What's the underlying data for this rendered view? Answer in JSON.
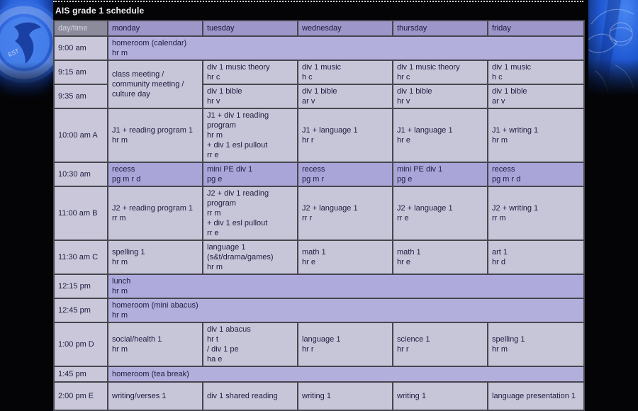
{
  "title": "AIS grade 1 schedule",
  "background": {
    "emblem_text": "EST",
    "emblem_blue": "#2a63dc"
  },
  "colors": {
    "header_purple": "#9c96c9",
    "header_gray": "#8c8b9b",
    "cell_light": "#c7c5d8",
    "homeroom_purple": "#b3afdd",
    "lunch_purple": "#aeaadc",
    "recess_purple": "#a9a5d8",
    "text_dark": "#1e1e40"
  },
  "columns": [
    "day/time",
    "monday",
    "tuesday",
    "wednesday",
    "thursday",
    "friday"
  ],
  "rows": [
    {
      "time": "9:00 am",
      "span": "homeroom (calendar)\nhr m"
    },
    {
      "time": "9:15 am",
      "monday": "class meeting /\ncommunity meeting /\nculture day",
      "tuesday": "div 1 music theory\nhr c",
      "wednesday": "div 1 music\nh c",
      "thursday": "div 1 music theory\nhr c",
      "friday": "div 1 music\nh c"
    },
    {
      "time": "9:35 am",
      "tuesday": "div 1 bible\nhr v",
      "wednesday": "div 1 bible\nar v",
      "thursday": "div 1 bible\nhr v",
      "friday": "div 1 bible\nar v"
    },
    {
      "time": "10:00 am A",
      "monday": "J1 + reading program 1\nhr m",
      "tuesday": "J1 + div 1 reading program\nhr m\n+ div 1 esl pullout\nrr e",
      "wednesday": "J1 + language 1\nhr r",
      "thursday": "J1 + language 1\nhr e",
      "friday": "J1 + writing 1\nhr m"
    },
    {
      "time": "10:30 am",
      "monday": "recess\npg m r d",
      "tuesday": "mini PE div 1\npg e",
      "wednesday": "recess\npg m r",
      "thursday": "mini PE div 1\npg e",
      "friday": "recess\npg m r d"
    },
    {
      "time": "11:00 am B",
      "monday": "J2 + reading program 1\nrr m",
      "tuesday": "J2 + div 1 reading program\nrr m\n+ div 1 esl pullout\nrr e",
      "wednesday": "J2 + language 1\nrr r",
      "thursday": "J2 + language 1\nrr e",
      "friday": "J2 + writing 1\nrr m"
    },
    {
      "time": "11:30 am C",
      "monday": "spelling 1\nhr m",
      "tuesday": "language 1 (s&t/drama/games)\nhr m",
      "wednesday": "math 1\nhr e",
      "thursday": "math 1\nhr e",
      "friday": "art 1\nhr d"
    },
    {
      "time": "12:15 pm",
      "span": "lunch\nhr m"
    },
    {
      "time": "12:45 pm",
      "span": "homeroom (mini abacus)\nhr m"
    },
    {
      "time": "1:00 pm D",
      "monday": "social/health 1\nhr m",
      "tuesday": "div 1 abacus\nhr t\n/ div 1 pe\nha e",
      "wednesday": "language 1\nhr r",
      "thursday": "science 1\nhr r",
      "friday": "spelling 1\nhr m"
    },
    {
      "time": "1:45 pm",
      "span": "homeroom (tea break)"
    },
    {
      "time": "2:00 pm E",
      "monday": "writing/verses 1",
      "tuesday": "div 1 shared reading",
      "wednesday": "writing 1",
      "thursday": "writing 1",
      "friday": "language presentation 1"
    }
  ]
}
